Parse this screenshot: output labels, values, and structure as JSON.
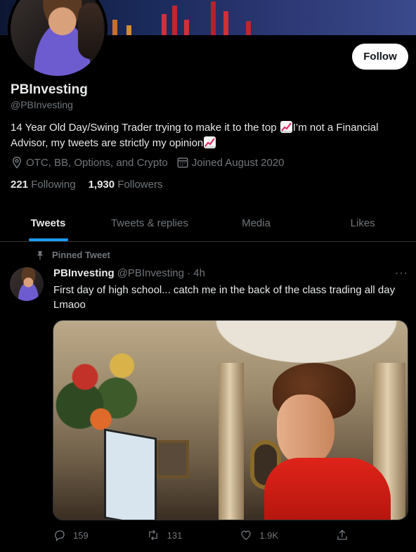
{
  "profile": {
    "display_name": "PBInvesting",
    "handle": "@PBInvesting",
    "bio_part1": "14 Year Old Day/Swing Trader trying to make it to the top ",
    "bio_part2": "I’m not a Financial Advisor, my tweets are strictly my opinion",
    "location": "OTC, BB, Options, and Crypto",
    "joined": "Joined August 2020",
    "following_count": "221",
    "following_label": "Following",
    "followers_count": "1,930",
    "followers_label": "Followers",
    "follow_label": "Follow",
    "icons": {
      "location": "location-pin-icon",
      "calendar": "calendar-icon",
      "chart_emoji": "chart-increasing-emoji"
    }
  },
  "tabs": [
    {
      "label": "Tweets",
      "active": true
    },
    {
      "label": "Tweets & replies",
      "active": false
    },
    {
      "label": "Media",
      "active": false
    },
    {
      "label": "Likes",
      "active": false
    }
  ],
  "tweet": {
    "pinned_label": "Pinned Tweet",
    "author_name": "PBInvesting",
    "author_handle_time": "@PBInvesting · 4h",
    "more_label": "···",
    "text": "First day of high school... catch me in the back of the class trading all day Lmaoo",
    "replies": "159",
    "retweets": "131",
    "likes": "1.9K"
  },
  "colors": {
    "accent": "#1d9bf0",
    "background": "#000000",
    "text_primary": "#e7e9ea",
    "text_secondary": "#71767b",
    "border": "#2f3336"
  }
}
